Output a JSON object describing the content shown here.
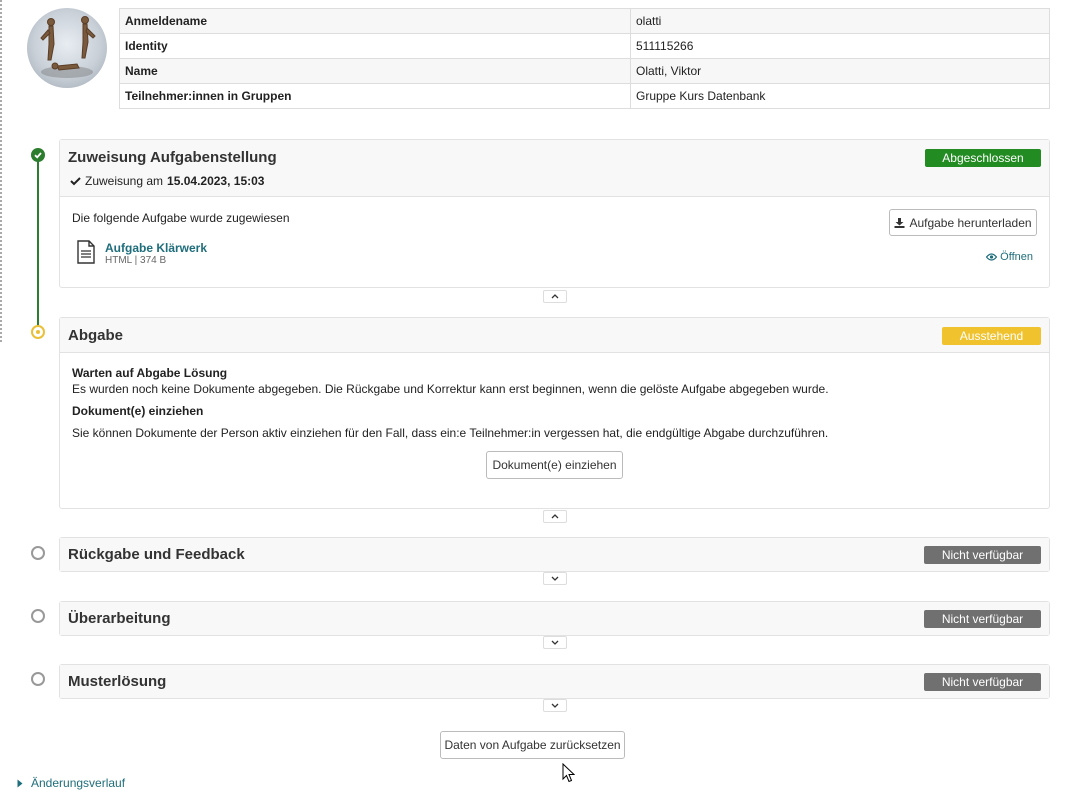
{
  "user": {
    "rows": [
      {
        "label": "Anmeldename",
        "value": "olatti"
      },
      {
        "label": "Identity",
        "value": "511115266"
      },
      {
        "label": "Name",
        "value": "Olatti, Viktor"
      },
      {
        "label": "Teilnehmer:innen in Gruppen",
        "value": "Gruppe Kurs Datenbank"
      }
    ]
  },
  "assignment": {
    "title": "Zuweisung Aufgabenstellung",
    "status": "Abgeschlossen",
    "meta_prefix": "Zuweisung am",
    "meta_date": "15.04.2023, 15:03",
    "intro": "Die folgende Aufgabe wurde zugewiesen",
    "download_label": "Aufgabe herunterladen",
    "file_name": "Aufgabe Klärwerk",
    "file_meta": "HTML | 374 B",
    "open_label": "Öffnen"
  },
  "submission": {
    "title": "Abgabe",
    "status": "Ausstehend",
    "wait_heading": "Warten auf Abgabe Lösung",
    "wait_text": "Es wurden noch keine Dokumente abgegeben. Die Rückgabe und Korrektur kann erst beginnen, wenn die gelöste Aufgabe abgegeben wurde.",
    "collect_heading": "Dokument(e) einziehen",
    "collect_text": "Sie können Dokumente der Person aktiv einziehen für den Fall, dass ein:e Teilnehmer:in vergessen hat, die endgültige Abgabe durchzuführen.",
    "collect_button": "Dokument(e) einziehen"
  },
  "feedback": {
    "title": "Rückgabe und Feedback",
    "status": "Nicht verfügbar"
  },
  "revision": {
    "title": "Überarbeitung",
    "status": "Nicht verfügbar"
  },
  "solution": {
    "title": "Musterlösung",
    "status": "Nicht verfügbar"
  },
  "reset_button": "Daten von Aufgabe zurücksetzen",
  "history_label": "Änderungsverlauf",
  "colors": {
    "done": "#228b22",
    "pending": "#efc22e",
    "unavailable": "#707070",
    "link": "#1f6e7c"
  }
}
